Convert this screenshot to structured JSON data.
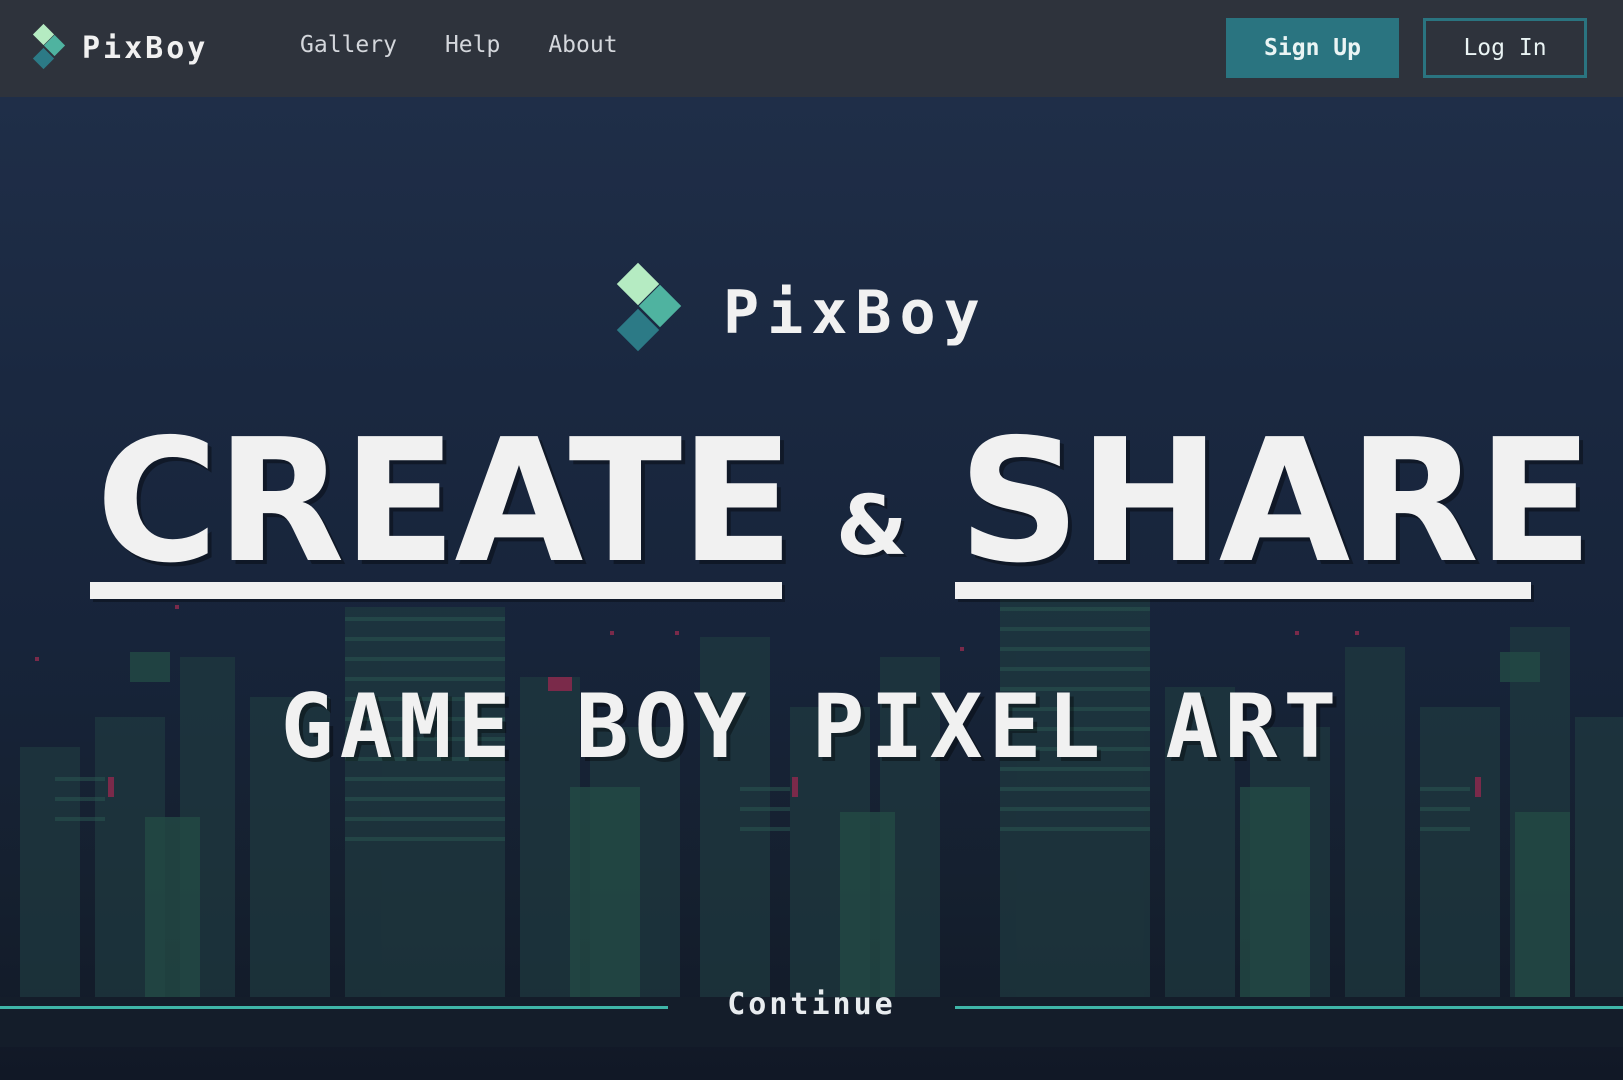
{
  "navbar": {
    "brand": "PixBoy",
    "links": [
      "Gallery",
      "Help",
      "About"
    ],
    "signup_label": "Sign Up",
    "login_label": "Log In"
  },
  "hero": {
    "brand": "PixBoy",
    "headline_word1": "CREATE",
    "headline_amp": "&",
    "headline_word2": "SHARE",
    "subheadline": "GAME BOY PIXEL ART",
    "continue_label": "Continue"
  },
  "colors": {
    "navbar_bg": "#2e333c",
    "accent": "#2a7480",
    "accent_line": "#3fb5a8",
    "logo_light": "#b5ebc2",
    "logo_mid": "#4fb3a0",
    "logo_dark": "#2c7a86",
    "text": "#f1f1f1"
  },
  "icons": [
    "pixboy-logo-icon"
  ]
}
